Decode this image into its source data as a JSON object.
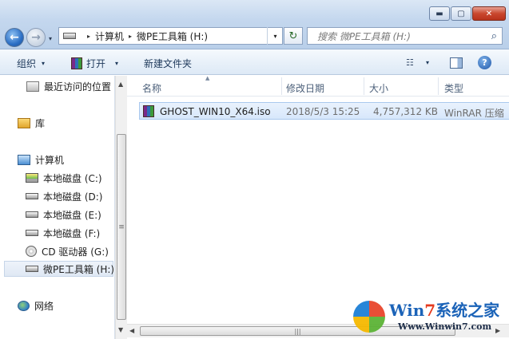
{
  "window": {
    "minimize_glyph": "▬",
    "maximize_glyph": "▢",
    "close_glyph": "✕"
  },
  "navigation": {
    "back_glyph": "←",
    "forward_glyph": "→",
    "history_glyph": "▾"
  },
  "address": {
    "crumbs": [
      "计算机",
      "微PE工具箱 (H:)"
    ],
    "separator": "▸",
    "dropdown_glyph": "▾",
    "refresh_glyph": "↻"
  },
  "search": {
    "placeholder": "搜索 微PE工具箱 (H:)",
    "icon_glyph": "⌕"
  },
  "toolbar": {
    "organize_label": "组织",
    "open_label": "打开",
    "new_folder_label": "新建文件夹",
    "caret_glyph": "▾",
    "views_glyph": "☷",
    "help_glyph": "?"
  },
  "sidebar": {
    "items": [
      {
        "label": "最近访问的位置",
        "icon": "recent-places-icon"
      },
      {
        "label": "库",
        "icon": "libraries-icon"
      },
      {
        "label": "计算机",
        "icon": "computer-icon"
      },
      {
        "label": "本地磁盘 (C:)",
        "icon": "system-disk-icon"
      },
      {
        "label": "本地磁盘 (D:)",
        "icon": "disk-icon"
      },
      {
        "label": "本地磁盘 (E:)",
        "icon": "disk-icon"
      },
      {
        "label": "本地磁盘 (F:)",
        "icon": "disk-icon"
      },
      {
        "label": "CD 驱动器 (G:)",
        "icon": "cd-drive-icon"
      },
      {
        "label": "微PE工具箱 (H:)",
        "icon": "disk-icon"
      },
      {
        "label": "网络",
        "icon": "network-icon"
      }
    ],
    "scroll_up_glyph": "▲",
    "scroll_down_glyph": "▼",
    "thumb_grip": "≡"
  },
  "file_list": {
    "columns": [
      "名称",
      "修改日期",
      "大小",
      "类型"
    ],
    "sort_glyph": "▲",
    "rows": [
      {
        "name": "GHOST_WIN10_X64.iso",
        "modified": "2018/5/3 15:25",
        "size": "4,757,312 KB",
        "type": "WinRAR 压缩"
      }
    ],
    "hscroll_left_glyph": "◀",
    "hscroll_right_glyph": "▶",
    "hscroll_grip": "|||"
  },
  "watermark": {
    "title_a": "Win",
    "title_b": "7",
    "title_c": "系统之家",
    "url": "Www.Winwin7.com"
  }
}
